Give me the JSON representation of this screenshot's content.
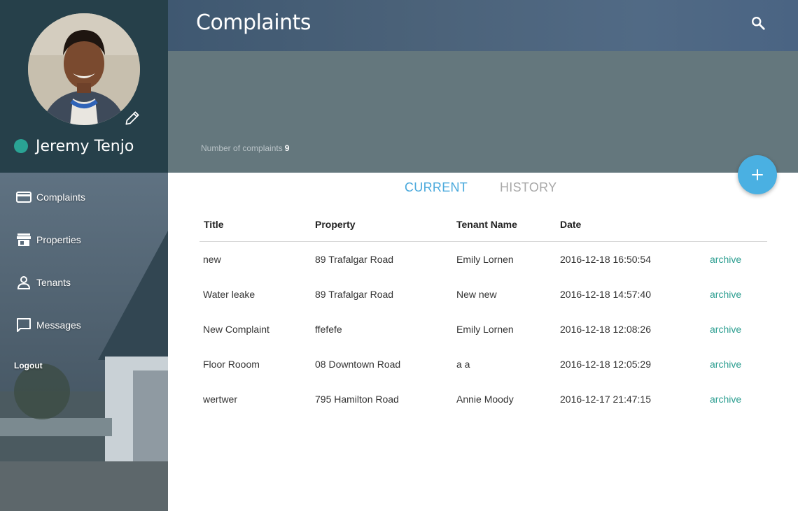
{
  "user": {
    "name": "Jeremy Tenjo",
    "status_color": "#2aa394"
  },
  "nav": {
    "items": [
      {
        "label": "Complaints",
        "icon": "card-icon"
      },
      {
        "label": "Properties",
        "icon": "store-icon"
      },
      {
        "label": "Tenants",
        "icon": "person-icon"
      },
      {
        "label": "Messages",
        "icon": "chat-icon"
      }
    ],
    "logout": "Logout"
  },
  "header": {
    "title": "Complaints",
    "count_label": "Number of complaints",
    "count_value": "9"
  },
  "tabs": {
    "current": "CURRENT",
    "history": "HISTORY"
  },
  "table": {
    "columns": [
      "Title",
      "Property",
      "Tenant Name",
      "Date"
    ],
    "rows": [
      {
        "title": "new",
        "property": "89 Trafalgar Road",
        "tenant": "Emily Lornen",
        "date": "2016-12-18 16:50:54",
        "action": "archive"
      },
      {
        "title": "Water leake",
        "property": "89 Trafalgar Road",
        "tenant": "New new",
        "date": "2016-12-18 14:57:40",
        "action": "archive"
      },
      {
        "title": "New Complaint",
        "property": "ffefefe",
        "tenant": "Emily Lornen",
        "date": "2016-12-18 12:08:26",
        "action": "archive"
      },
      {
        "title": "Floor Rooom",
        "property": "08 Downtown Road",
        "tenant": "a a",
        "date": "2016-12-18 12:05:29",
        "action": "archive"
      },
      {
        "title": "wertwer",
        "property": "795 Hamilton Road",
        "tenant": "Annie Moody",
        "date": "2016-12-17 21:47:15",
        "action": "archive"
      }
    ]
  },
  "colors": {
    "accent": "#4aa9dc",
    "fab": "#4ab0e2",
    "link": "#2a9d8f"
  }
}
